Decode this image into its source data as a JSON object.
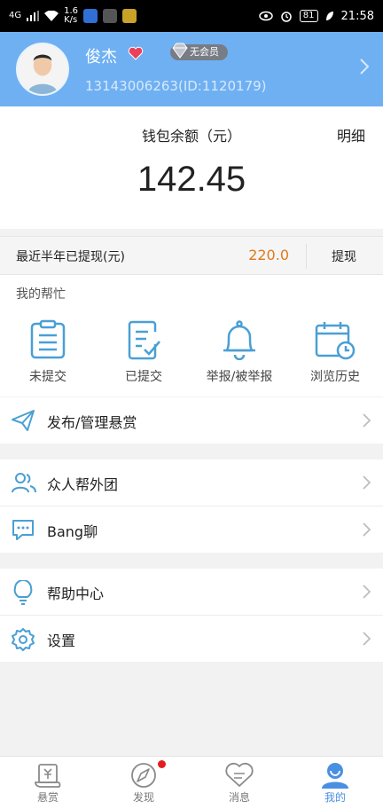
{
  "status_bar": {
    "network": "4G",
    "speed_value": "1.6",
    "speed_unit": "K/s",
    "battery": "81",
    "time": "21:58"
  },
  "profile": {
    "name": "俊杰",
    "membership": "无会员",
    "id_line": "13143006263(ID:1120179)"
  },
  "wallet": {
    "label": "钱包余额（元）",
    "detail": "明细",
    "balance": "142.45"
  },
  "withdraw": {
    "label": "最近半年已提现(元)",
    "amount": "220.0",
    "button": "提现"
  },
  "help": {
    "title": "我的帮忙",
    "items": [
      {
        "label": "未提交",
        "icon": "clipboard-icon"
      },
      {
        "label": "已提交",
        "icon": "submitted-doc-icon"
      },
      {
        "label": "举报/被举报",
        "icon": "bell-icon"
      },
      {
        "label": "浏览历史",
        "icon": "calendar-clock-icon"
      }
    ]
  },
  "menu": {
    "publish": "发布/管理悬赏",
    "group": "众人帮外团",
    "chat": "Bang聊",
    "help_center": "帮助中心",
    "settings": "设置"
  },
  "nav": {
    "items": [
      {
        "label": "悬赏",
        "icon": "reward-scroll-icon"
      },
      {
        "label": "发现",
        "icon": "discover-icon"
      },
      {
        "label": "消息",
        "icon": "message-icon"
      },
      {
        "label": "我的",
        "icon": "profile-icon"
      }
    ]
  },
  "colors": {
    "header_blue": "#6fb0f3",
    "accent_blue": "#4a90e2",
    "icon_blue": "#4a9fd4",
    "withdraw_orange": "#e07a1a",
    "badge_red": "#e0201f"
  }
}
